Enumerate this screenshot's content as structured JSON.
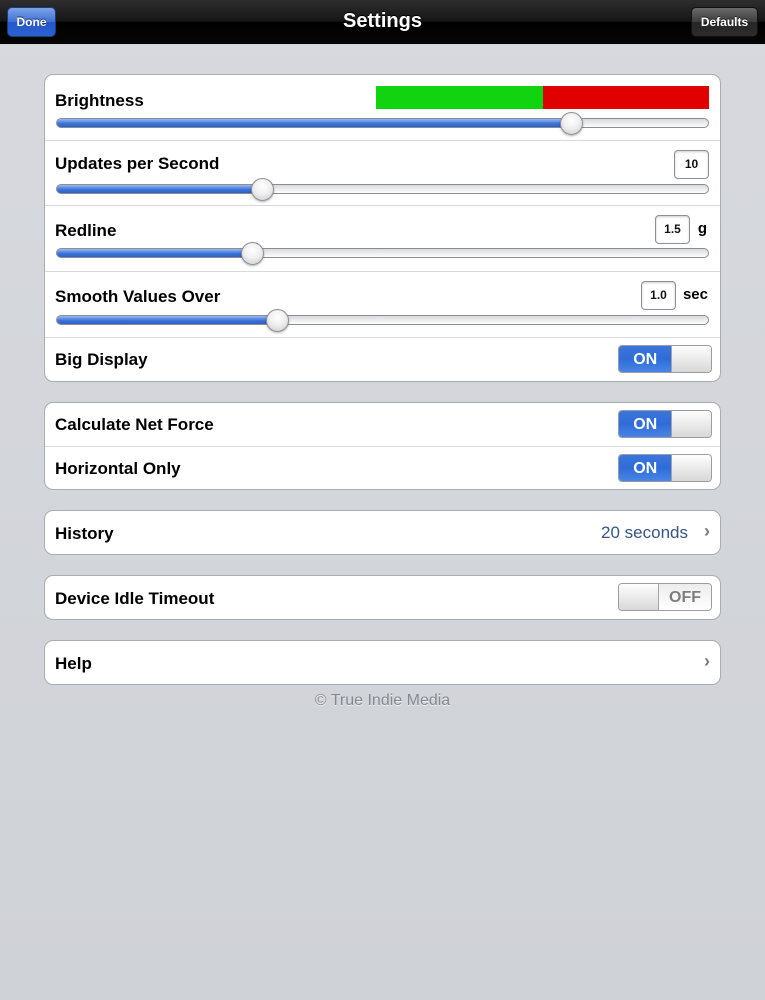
{
  "navbar": {
    "title": "Settings",
    "done_label": "Done",
    "defaults_label": "Defaults"
  },
  "display_group": {
    "brightness": {
      "label": "Brightness",
      "value_fraction": 0.79,
      "preview_colors": [
        "#0fd40f",
        "#e00000"
      ]
    },
    "updates": {
      "label": "Updates per Second",
      "value": "10",
      "value_fraction": 0.315
    },
    "redline": {
      "label": "Redline",
      "value": "1.5",
      "unit": "g",
      "value_fraction": 0.3
    },
    "smooth": {
      "label": "Smooth Values Over",
      "value": "1.0",
      "unit": "sec",
      "value_fraction": 0.338
    },
    "big_display": {
      "label": "Big Display",
      "state": "ON"
    }
  },
  "force_group": {
    "net_force": {
      "label": "Calculate Net Force",
      "state": "ON"
    },
    "horizontal": {
      "label": "Horizontal Only",
      "state": "ON"
    }
  },
  "history": {
    "label": "History",
    "value": "20 seconds"
  },
  "idle": {
    "label": "Device Idle Timeout",
    "state": "OFF"
  },
  "help": {
    "label": "Help"
  },
  "footer": "© True Indie Media",
  "colors": {
    "accent": "#2f6cd8",
    "detail_text": "#385487"
  }
}
